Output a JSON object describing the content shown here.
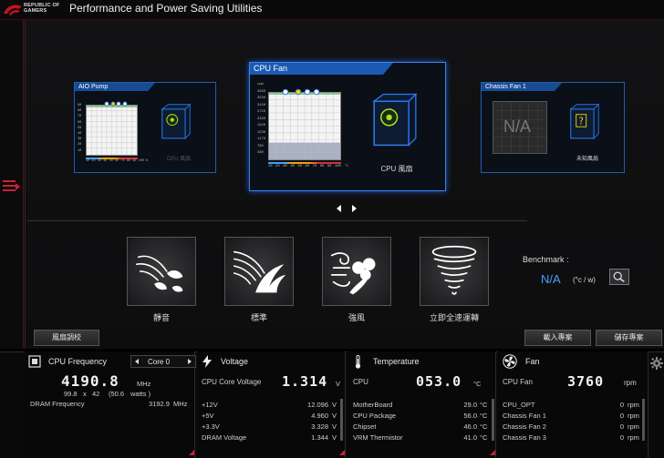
{
  "app": {
    "brand_line1": "REPUBLIC OF",
    "brand_line2": "GAMERS",
    "title": "Performance and Power Saving Utilities"
  },
  "fans": [
    {
      "title": "AIO Pump",
      "caption": "CPU 風扇",
      "y_ticks": [
        "90",
        "80",
        "70",
        "60",
        "50",
        "40",
        "30",
        "20",
        "10"
      ],
      "x_ticks": [
        "10",
        "20",
        "30",
        "40",
        "50",
        "60",
        "70",
        "80",
        "90",
        "100 %"
      ]
    },
    {
      "title": "CPU Fan",
      "caption": "CPU 風扇",
      "y_ticks": [
        "rpm",
        "3960",
        "3530",
        "3150",
        "2720",
        "2340",
        "1920",
        "1530",
        "1170",
        "780",
        "390"
      ],
      "x_ticks": [
        "10",
        "20",
        "30",
        "40",
        "50",
        "60",
        "70",
        "80",
        "90",
        "100",
        "°C"
      ]
    },
    {
      "title": "Chassis Fan 1",
      "caption": "未知風扇",
      "na_label": "N/A"
    }
  ],
  "modes": [
    {
      "label": "靜音",
      "icon": "silent-leaf-icon"
    },
    {
      "label": "標準",
      "icon": "standard-wind-icon"
    },
    {
      "label": "強風",
      "icon": "turbo-wind-icon"
    },
    {
      "label": "立即全速運轉",
      "icon": "full-speed-tornado-icon"
    }
  ],
  "benchmark": {
    "label": "Benchmark :",
    "value": "N/A",
    "unit": "(°c / w)"
  },
  "buttons": {
    "fan_tuning": "風扇調校",
    "load_profile": "載入專案",
    "save_profile": "儲存專案"
  },
  "cpu_frequency": {
    "title": "CPU Frequency",
    "core_selector": "Core 0",
    "freq_value": "4190.8",
    "freq_unit": "MHz",
    "detail_bclk": "99.8",
    "detail_x": "x",
    "detail_ratio": "42",
    "detail_power": "(50.6",
    "detail_power_unit": "watts )",
    "dram_label": "DRAM Frequency",
    "dram_value": "3192.9",
    "dram_unit": "MHz"
  },
  "voltage": {
    "title": "Voltage",
    "core_label": "CPU Core Voltage",
    "core_value": "1.314",
    "core_unit": "V",
    "rows": [
      {
        "label": "+12V",
        "value": "12.096",
        "unit": "V"
      },
      {
        "label": "+5V",
        "value": "4.960",
        "unit": "V"
      },
      {
        "label": "+3.3V",
        "value": "3.328",
        "unit": "V"
      },
      {
        "label": "DRAM Voltage",
        "value": "1.344",
        "unit": "V"
      }
    ]
  },
  "temperature": {
    "title": "Temperature",
    "cpu_label": "CPU",
    "cpu_value": "053.0",
    "cpu_unit": "°C",
    "rows": [
      {
        "label": "MotherBoard",
        "value": "29.0",
        "unit": "°C"
      },
      {
        "label": "CPU Package",
        "value": "56.0",
        "unit": "°C"
      },
      {
        "label": "Chipset",
        "value": "46.0",
        "unit": "°C"
      },
      {
        "label": "VRM Thermistor",
        "value": "41.0",
        "unit": "°C"
      }
    ]
  },
  "fan_panel": {
    "title": "Fan",
    "cpu_label": "CPU Fan",
    "cpu_value": "3760",
    "cpu_unit": "rpm",
    "rows": [
      {
        "label": "CPU_OPT",
        "value": "0",
        "unit": "rpm"
      },
      {
        "label": "Chassis Fan 1",
        "value": "0",
        "unit": "rpm"
      },
      {
        "label": "Chassis Fan 2",
        "value": "0",
        "unit": "rpm"
      },
      {
        "label": "Chassis Fan 3",
        "value": "0",
        "unit": "rpm"
      }
    ]
  },
  "colors": {
    "accent_red": "#d02030",
    "accent_blue": "#1a5ab3",
    "value_blue": "#4aa0ff"
  }
}
